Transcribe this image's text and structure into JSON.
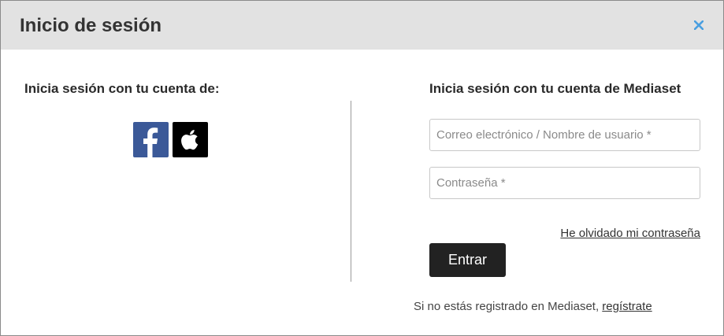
{
  "modal": {
    "title": "Inicio de sesión",
    "close_icon": "close-icon",
    "colors": {
      "header_bg": "#e2e2e2",
      "close": "#4a9fe0",
      "button_bg": "#222222"
    }
  },
  "social": {
    "heading": "Inicia sesión con tu cuenta de:",
    "providers": [
      {
        "name": "facebook",
        "icon": "facebook-icon",
        "color": "#3b5998"
      },
      {
        "name": "apple",
        "icon": "apple-icon",
        "color": "#000000"
      }
    ]
  },
  "login": {
    "heading": "Inicia sesión con tu cuenta de Mediaset",
    "email": {
      "value": "",
      "placeholder": "Correo electrónico / Nombre de usuario *"
    },
    "password": {
      "value": "",
      "placeholder": "Contraseña *"
    },
    "forgot_label": "He olvidado mi contraseña",
    "submit_label": "Entrar",
    "register_prefix": "Si no estás registrado en Mediaset, ",
    "register_label": "regístrate"
  }
}
